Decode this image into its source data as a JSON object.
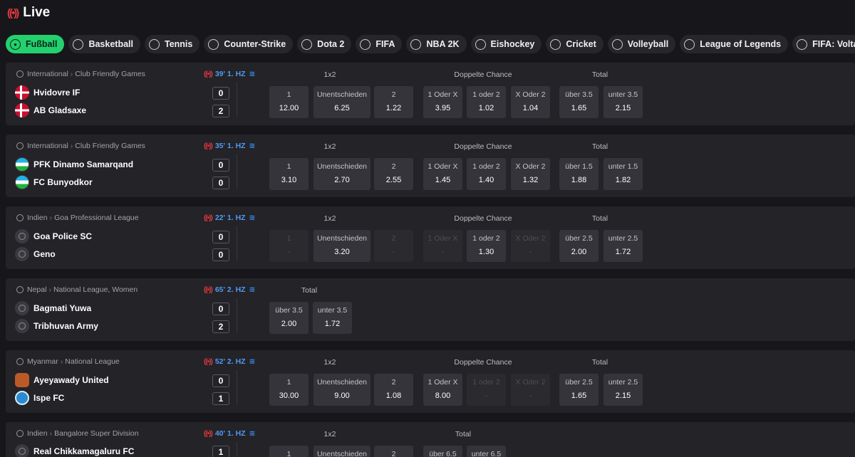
{
  "header": {
    "title": "Live",
    "live_icon": "broadcast-icon"
  },
  "tabs": [
    {
      "label": "Fußball",
      "icon": "soccer-ball-icon",
      "active": true
    },
    {
      "label": "Basketball",
      "icon": "basketball-icon"
    },
    {
      "label": "Tennis",
      "icon": "tennis-racket-icon"
    },
    {
      "label": "Counter-Strike",
      "icon": "soldier-icon"
    },
    {
      "label": "Dota 2",
      "icon": "dota-icon"
    },
    {
      "label": "FIFA",
      "icon": "fifa-icon"
    },
    {
      "label": "NBA 2K",
      "icon": "nba2k-icon"
    },
    {
      "label": "Eishockey",
      "icon": "hockey-icon"
    },
    {
      "label": "Cricket",
      "icon": "cricket-icon"
    },
    {
      "label": "Volleyball",
      "icon": "volleyball-icon"
    },
    {
      "label": "League of Legends",
      "icon": "lol-icon"
    },
    {
      "label": "FIFA: Volta",
      "icon": "fifa-volta-icon"
    },
    {
      "label": "",
      "icon": "more-icon"
    }
  ],
  "matches": [
    {
      "country": "International",
      "competition": "Club Friendly Games",
      "clock": "39' 1. HZ",
      "home": {
        "name": "Hvidovre IF",
        "score": "0",
        "flag": "dk"
      },
      "away": {
        "name": "AB Gladsaxe",
        "score": "2",
        "flag": "dk"
      },
      "markets": {
        "h1x2": "1x2",
        "hdc": "Doppelte Chance",
        "htot": "Total",
        "m1": {
          "l": "1",
          "v": "12.00"
        },
        "mX": {
          "l": "Unentschieden",
          "v": "6.25"
        },
        "m2": {
          "l": "2",
          "v": "1.22"
        },
        "d1": {
          "l": "1 Oder X",
          "v": "3.95"
        },
        "d2": {
          "l": "1 oder 2",
          "v": "1.02"
        },
        "d3": {
          "l": "X Oder 2",
          "v": "1.04"
        },
        "t1": {
          "l": "über 3.5",
          "v": "1.65"
        },
        "t2": {
          "l": "unter 3.5",
          "v": "2.15"
        }
      }
    },
    {
      "country": "International",
      "competition": "Club Friendly Games",
      "clock": "35' 1. HZ",
      "home": {
        "name": "PFK Dinamo Samarqand",
        "score": "0",
        "flag": "uz"
      },
      "away": {
        "name": "FC Bunyodkor",
        "score": "0",
        "flag": "uz"
      },
      "markets": {
        "h1x2": "1x2",
        "hdc": "Doppelte Chance",
        "htot": "Total",
        "m1": {
          "l": "1",
          "v": "3.10"
        },
        "mX": {
          "l": "Unentschieden",
          "v": "2.70"
        },
        "m2": {
          "l": "2",
          "v": "2.55"
        },
        "d1": {
          "l": "1 Oder X",
          "v": "1.45"
        },
        "d2": {
          "l": "1 oder 2",
          "v": "1.40"
        },
        "d3": {
          "l": "X Oder 2",
          "v": "1.32"
        },
        "t1": {
          "l": "über 1.5",
          "v": "1.88"
        },
        "t2": {
          "l": "unter 1.5",
          "v": "1.82"
        }
      }
    },
    {
      "country": "Indien",
      "competition": "Goa Professional League",
      "clock": "22' 1. HZ",
      "home": {
        "name": "Goa Police SC",
        "score": "0",
        "flag": "gen"
      },
      "away": {
        "name": "Geno",
        "score": "0",
        "flag": "gen"
      },
      "markets": {
        "h1x2": "1x2",
        "hdc": "Doppelte Chance",
        "htot": "Total",
        "m1": {
          "l": "1",
          "v": "-"
        },
        "mX": {
          "l": "Unentschieden",
          "v": "3.20"
        },
        "m2": {
          "l": "2",
          "v": "-"
        },
        "d1": {
          "l": "1 Oder X",
          "v": "-"
        },
        "d2": {
          "l": "1 oder 2",
          "v": "1.30"
        },
        "d3": {
          "l": "X Oder 2",
          "v": "-"
        },
        "t1": {
          "l": "über 2.5",
          "v": "2.00"
        },
        "t2": {
          "l": "unter 2.5",
          "v": "1.72"
        }
      }
    },
    {
      "country": "Nepal",
      "competition": "National League, Women",
      "clock": "65' 2. HZ",
      "home": {
        "name": "Bagmati Yuwa",
        "score": "0",
        "flag": "gen"
      },
      "away": {
        "name": "Tribhuvan Army",
        "score": "2",
        "flag": "gen"
      },
      "markets": {
        "htot": "Total",
        "t1": {
          "l": "über 3.5",
          "v": "2.00"
        },
        "t2": {
          "l": "unter 3.5",
          "v": "1.72"
        }
      }
    },
    {
      "country": "Myanmar",
      "competition": "National League",
      "clock": "52' 2. HZ",
      "home": {
        "name": "Ayeyawady United",
        "score": "0",
        "flag": "ay"
      },
      "away": {
        "name": "Ispe FC",
        "score": "1",
        "flag": "ip"
      },
      "markets": {
        "h1x2": "1x2",
        "hdc": "Doppelte Chance",
        "htot": "Total",
        "m1": {
          "l": "1",
          "v": "30.00"
        },
        "mX": {
          "l": "Unentschieden",
          "v": "9.00"
        },
        "m2": {
          "l": "2",
          "v": "1.08"
        },
        "d1": {
          "l": "1 Oder X",
          "v": "8.00"
        },
        "d2": {
          "l": "1 oder 2",
          "v": "-"
        },
        "d3": {
          "l": "X Oder 2",
          "v": "-"
        },
        "t1": {
          "l": "über 2.5",
          "v": "1.65"
        },
        "t2": {
          "l": "unter 2.5",
          "v": "2.15"
        }
      }
    },
    {
      "country": "Indien",
      "competition": "Bangalore Super Division",
      "clock": "40' 1. HZ",
      "home": {
        "name": "Real Chikkamagaluru FC",
        "score": "1",
        "flag": "gen"
      },
      "markets": {
        "h1x2": "1x2",
        "htot": "Total",
        "m1": {
          "l": "1",
          "v": ""
        },
        "mX": {
          "l": "Unentschieden",
          "v": ""
        },
        "m2": {
          "l": "2",
          "v": ""
        },
        "t1": {
          "l": "über 6.5",
          "v": ""
        },
        "t2": {
          "l": "unter 6.5",
          "v": ""
        }
      }
    }
  ]
}
